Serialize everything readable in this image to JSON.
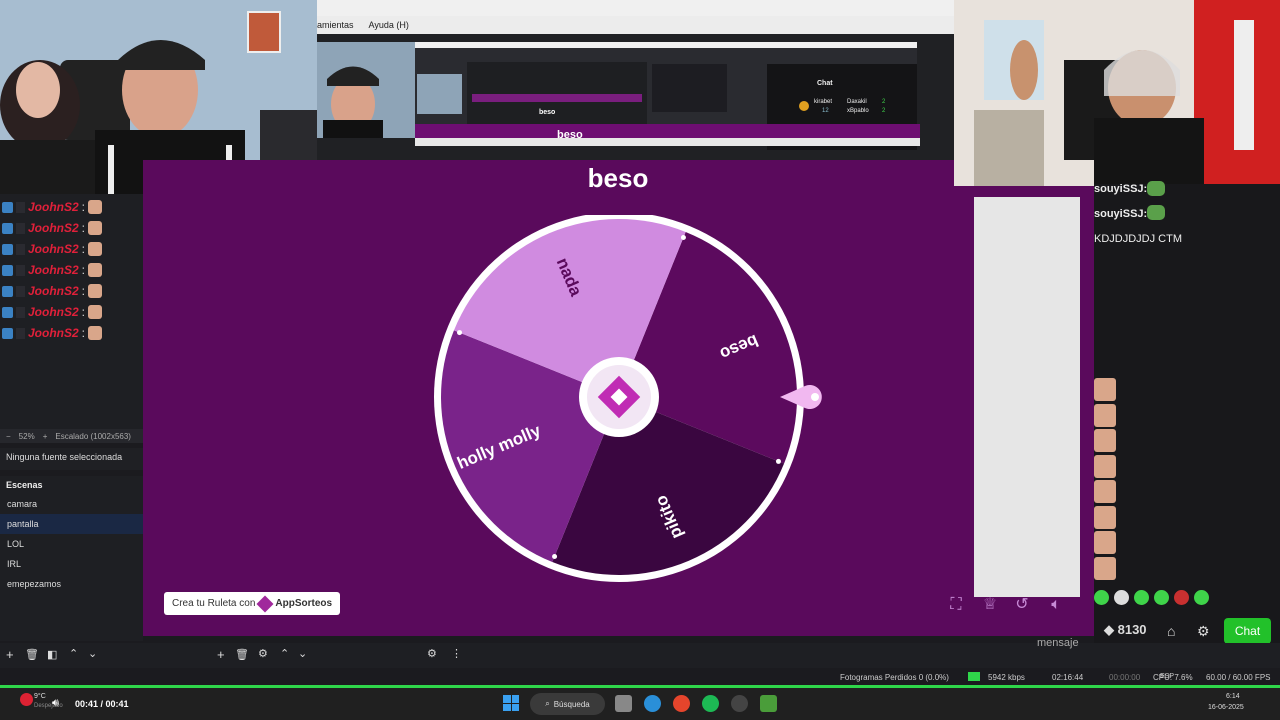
{
  "menu": {
    "item1": "amientas",
    "item2": "Ayuda (H)"
  },
  "nested": {
    "chat_title": "Chat",
    "user1": "kirabet",
    "user2": "Daxakil",
    "user3": "xBpablo",
    "n1": "2",
    "n2": "12",
    "n3": "2",
    "mini_label1": "beso",
    "mini_label2": "beso"
  },
  "roulette": {
    "title": "beso",
    "segments": [
      {
        "label": "nada",
        "color": "#d08be0"
      },
      {
        "label": "beso",
        "color": "#5c0a5e"
      },
      {
        "label": "pikito",
        "color": "#3a0640"
      },
      {
        "label": "holly molly",
        "color": "#7a238a"
      }
    ],
    "credit_prefix": "Crea tu Ruleta con",
    "credit_brand": "AppSorteos"
  },
  "obs": {
    "chat_user": "JoohnS2",
    "zoom": "52%",
    "scale": "Escalado (1002x563)",
    "no_source": "Ninguna fuente seleccionada",
    "scenes_title": "Escenas",
    "scenes": [
      "camara",
      "pantalla",
      "LOL",
      "IRL",
      "emepezamos"
    ],
    "status_dropped": "Fotogramas Perdidos 0 (0.0%)",
    "status_kbps": "5942 kbps",
    "status_time": "02:16:44",
    "status_rec": "00:00:00",
    "status_cpu": "CPU: 7.6%",
    "status_fps": "60.00 / 60.00 FPS",
    "message": "mensaje"
  },
  "twitch": {
    "user": "souyiSSJ:",
    "message": "KDJDJDJDJ CTM",
    "bits": "8130",
    "chat_button": "Chat"
  },
  "taskbar": {
    "weather": "9°C",
    "weather_sub": "Despejado",
    "media_time": "00:41 / 00:41",
    "search": "Búsqueda",
    "clock": "6:14",
    "date": "16-06-2025",
    "lang": "ESP"
  },
  "colors": {
    "stage": "#5a0a5c",
    "accent_pink": "#c864d2",
    "green": "#22c12a"
  }
}
